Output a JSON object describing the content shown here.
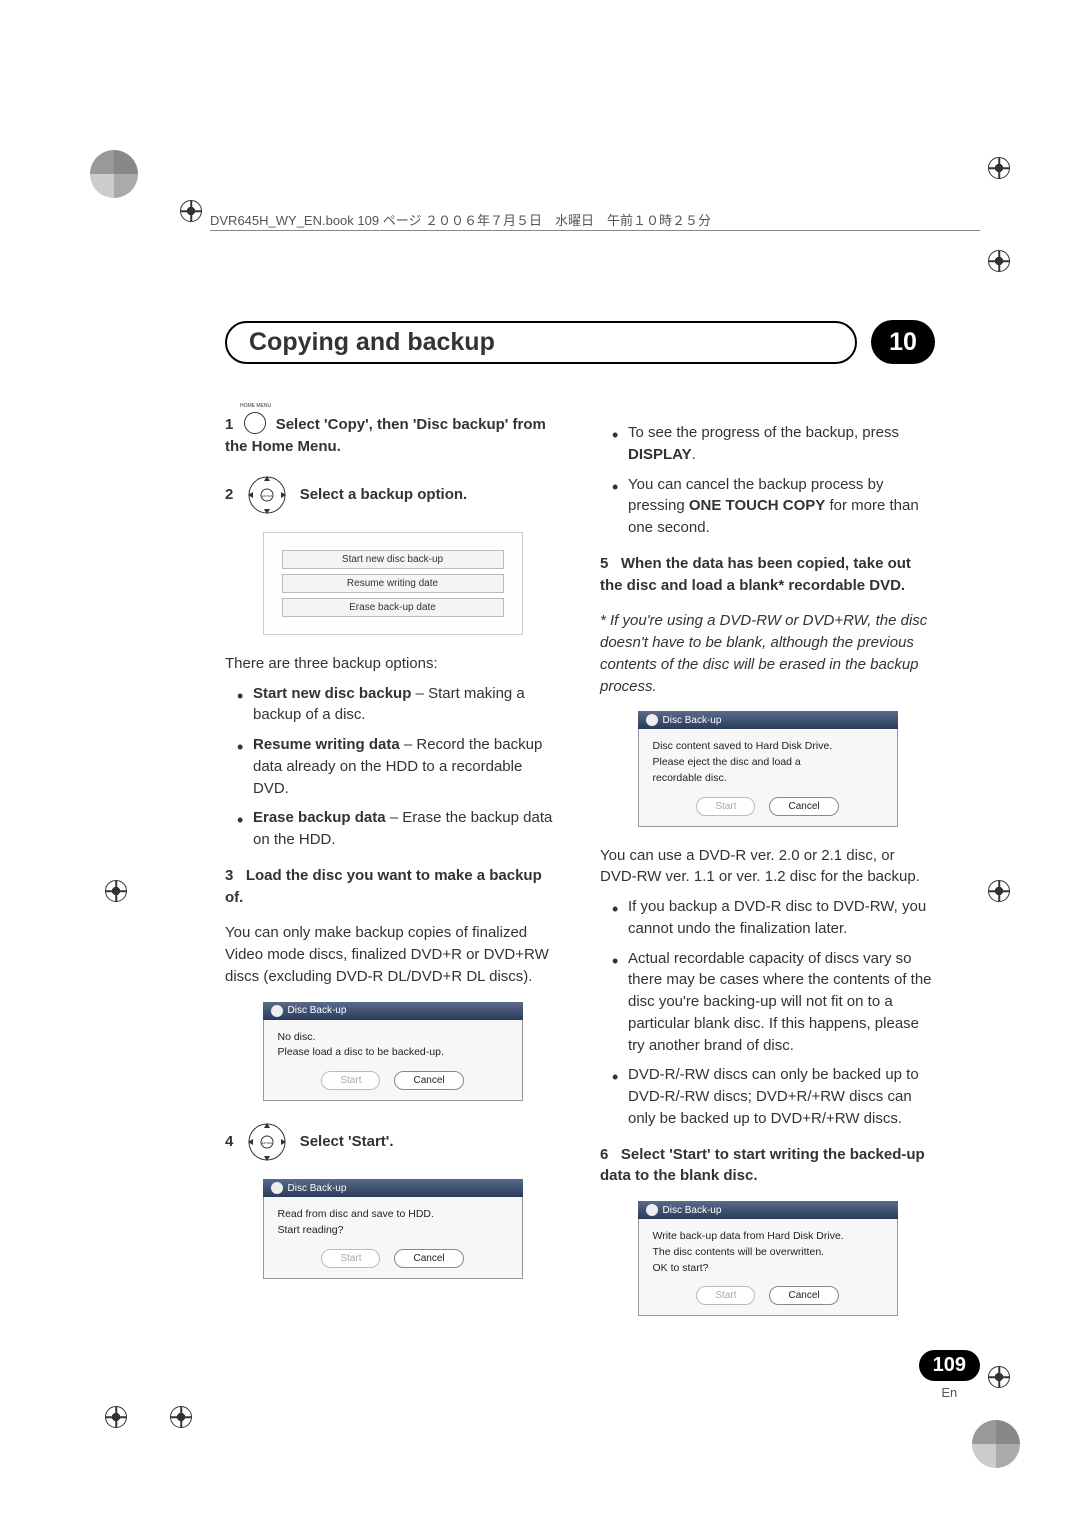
{
  "header": "DVR645H_WY_EN.book 109 ページ ２００６年７月５日　水曜日　午前１０時２５分",
  "titlebar": {
    "title": "Copying and backup",
    "chapter": "10"
  },
  "left": {
    "step1": {
      "num": "1",
      "text_a": "Select 'Copy', then 'Disc backup' from the Home Menu.",
      "icon_label": "HOME MENU"
    },
    "step2": {
      "num": "2",
      "text": "Select a backup option."
    },
    "menu": {
      "r1": "Start new disc back-up",
      "r2": "Resume writing date",
      "r3": "Erase back-up date"
    },
    "intro_options": "There are three backup options:",
    "opts": {
      "a_b": "Start new disc backup",
      "a": " – Start making a backup of a disc.",
      "b_b": "Resume writing data",
      "b": " – Record the backup data already on the HDD to a recordable DVD.",
      "c_b": "Erase backup data",
      "c": " – Erase the backup data on the HDD."
    },
    "step3": {
      "num": "3",
      "bold": "Load the disc you want to make a backup of."
    },
    "step3_p": "You can only make backup copies of finalized Video mode discs, finalized DVD+R or  DVD+RW discs (excluding DVD-R DL/DVD+R DL discs).",
    "dlg1": {
      "title": "Disc Back-up",
      "l1": "No disc.",
      "l2": "Please load a disc to be backed-up.",
      "start": "Start",
      "cancel": "Cancel"
    },
    "step4": {
      "num": "4",
      "text": "Select 'Start'."
    },
    "dlg2": {
      "title": "Disc Back-up",
      "l1": "Read from disc and save to HDD.",
      "l2": "Start reading?",
      "start": "Start",
      "cancel": "Cancel"
    }
  },
  "right": {
    "tips": {
      "a1": "To see the progress of the backup, press ",
      "a2": "DISPLAY",
      "a3": ".",
      "b1": "You can cancel the backup process by pressing ",
      "b2": "ONE TOUCH COPY",
      "b3": " for more than one second."
    },
    "step5": {
      "num": "5",
      "bold": "When the data has been copied, take out the disc and load a blank* recordable DVD."
    },
    "note5": "* If you're using a DVD-RW or DVD+RW, the disc doesn't have to be blank, although the previous contents of the disc will be erased in the backup process.",
    "dlg3": {
      "title": "Disc Back-up",
      "l1": "Disc content saved to Hard Disk Drive.",
      "l2": "Please eject the disc and load a",
      "l3": "recordable disc.",
      "start": "Start",
      "cancel": "Cancel"
    },
    "after5": "You can use a DVD-R ver. 2.0 or 2.1 disc, or DVD-RW ver. 1.1 or ver. 1.2 disc for the backup.",
    "bullets2": {
      "a": "If you backup a DVD-R disc to DVD-RW, you cannot undo the finalization later.",
      "b": "Actual recordable capacity of discs vary so there may be cases where the contents of the disc you're backing-up will not fit on to a particular blank disc. If this happens, please try another brand of disc.",
      "c": "DVD-R/-RW discs can only be backed up to DVD-R/-RW discs; DVD+R/+RW discs can only be backed up to DVD+R/+RW discs."
    },
    "step6": {
      "num": "6",
      "bold": "Select 'Start' to start writing the backed-up data to the blank disc."
    },
    "dlg4": {
      "title": "Disc Back-up",
      "l1": "Write back-up data from Hard Disk Drive.",
      "l2": "The disc contents will be overwritten.",
      "l3": "OK to start?",
      "start": "Start",
      "cancel": "Cancel"
    }
  },
  "pagenum": {
    "num": "109",
    "lang": "En"
  }
}
